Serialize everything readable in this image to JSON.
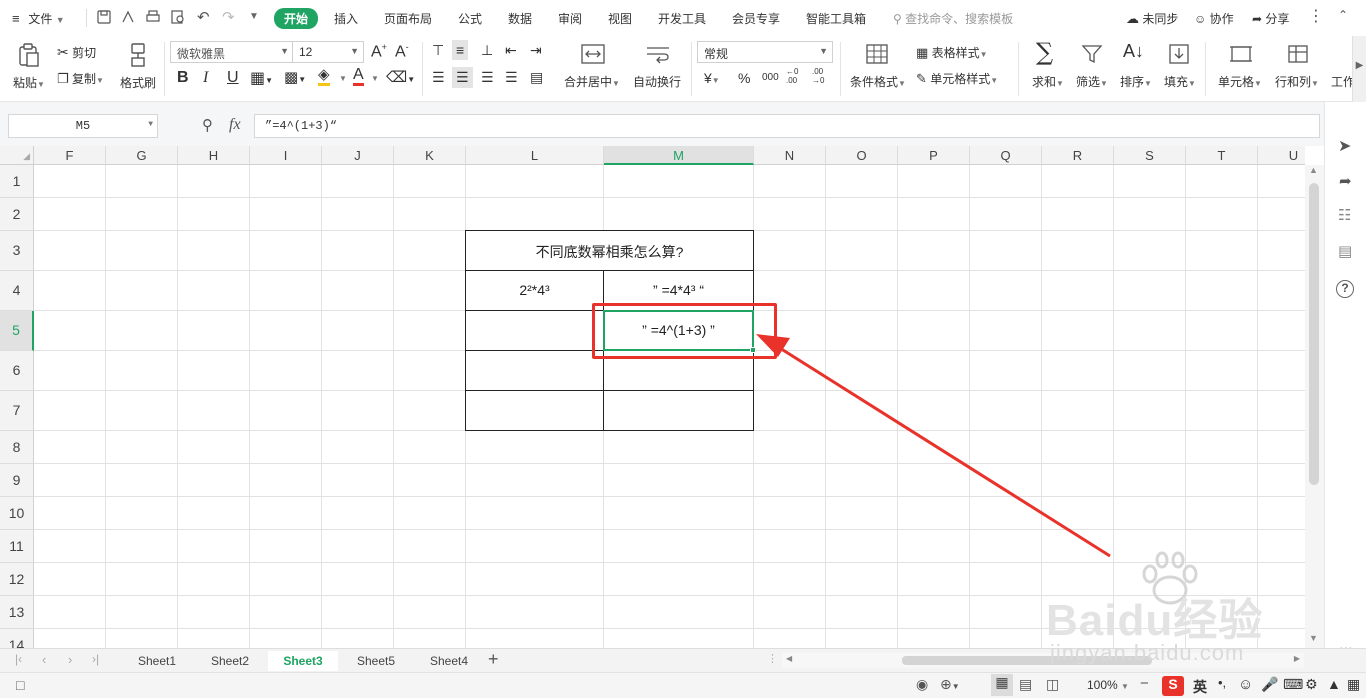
{
  "menubar": {
    "file_label": "文件",
    "tabs": [
      "开始",
      "插入",
      "页面布局",
      "公式",
      "数据",
      "审阅",
      "视图",
      "开发工具",
      "会员专享",
      "智能工具箱"
    ],
    "search_placeholder": "查找命令、搜索模板",
    "right_items": [
      "未同步",
      "协作",
      "分享"
    ]
  },
  "ribbon": {
    "paste": "粘贴",
    "cut": "剪切",
    "copy": "复制",
    "format_painter": "格式刷",
    "font_name": "微软雅黑",
    "font_size": "12",
    "merge_center": "合并居中",
    "wrap_text": "自动换行",
    "number_format": "常规",
    "conditional_format": "条件格式",
    "table_style": "表格样式",
    "cell_style": "单元格样式",
    "sum": "求和",
    "filter": "筛选",
    "sort": "排序",
    "fill": "填充",
    "cell": "单元格",
    "row_col": "行和列",
    "worksheet": "工作",
    "currency_symbol": "¥",
    "percent_symbol": "%",
    "thousands_symbol": "000",
    "inc_decimal": "←0 .00",
    "dec_decimal": ".00 →0"
  },
  "formula_bar": {
    "name_box": "M5",
    "fx_label": "fx",
    "formula": "”=4^(1+3)“"
  },
  "columns": [
    "F",
    "G",
    "H",
    "I",
    "J",
    "K",
    "L",
    "M",
    "N",
    "O",
    "P",
    "Q",
    "R",
    "S",
    "T",
    "U"
  ],
  "rows": [
    "1",
    "2",
    "3",
    "4",
    "5",
    "6",
    "7",
    "8",
    "9",
    "10",
    "11",
    "12",
    "13",
    "14"
  ],
  "selected_cell": {
    "column": "M",
    "row": "5"
  },
  "table": {
    "title": "不同底数幂相乘怎么算?",
    "r4_left": "2²*4³",
    "r4_right": "” =4*4³ “",
    "r5_right": "” =4^(1+3) ”"
  },
  "sheets": {
    "tabs": [
      "Sheet1",
      "Sheet2",
      "Sheet3",
      "Sheet5",
      "Sheet4"
    ],
    "active": "Sheet3"
  },
  "status": {
    "zoom": "100%",
    "ime_label": "英"
  },
  "watermark": {
    "brand": "Baidu经验",
    "url": "jingyan.baidu.com"
  },
  "colors": {
    "accent_green": "#1fa463",
    "annotation_red": "#e8322a"
  }
}
